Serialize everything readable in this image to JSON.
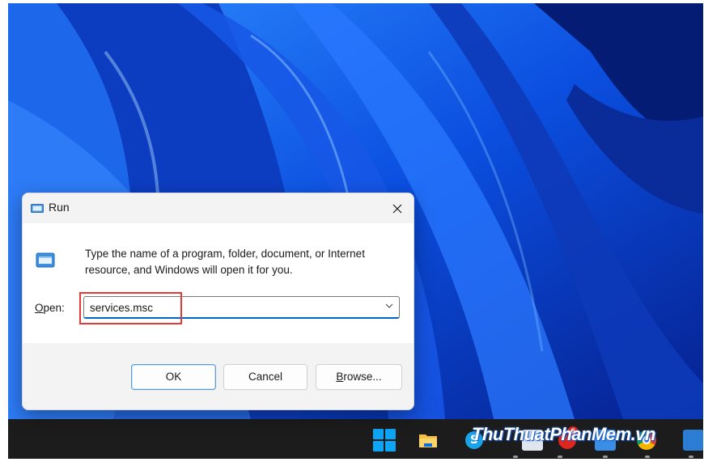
{
  "dialog": {
    "title": "Run",
    "description": "Type the name of a program, folder, document, or Internet resource, and Windows will open it for you.",
    "open_label_underlined": "O",
    "open_label_rest": "pen:",
    "open_value": "services.msc",
    "buttons": {
      "ok": "OK",
      "cancel": "Cancel",
      "browse_underlined": "B",
      "browse_rest": "rowse..."
    }
  },
  "taskbar": {
    "icons": [
      "windows-start-icon",
      "file-explorer-icon",
      "skype-icon",
      "mail-icon",
      "notification-app-icon",
      "app-icon",
      "chrome-icon",
      "word-icon"
    ],
    "badge_count": "6",
    "skype_letter": "S"
  },
  "watermark": "ThuThuatPhanMem.vn",
  "colors": {
    "wallpaper_blue": "#0a3fc8",
    "highlight_red": "#e53935",
    "accent": "#0067c0",
    "taskbar": "#1c1c1c"
  }
}
